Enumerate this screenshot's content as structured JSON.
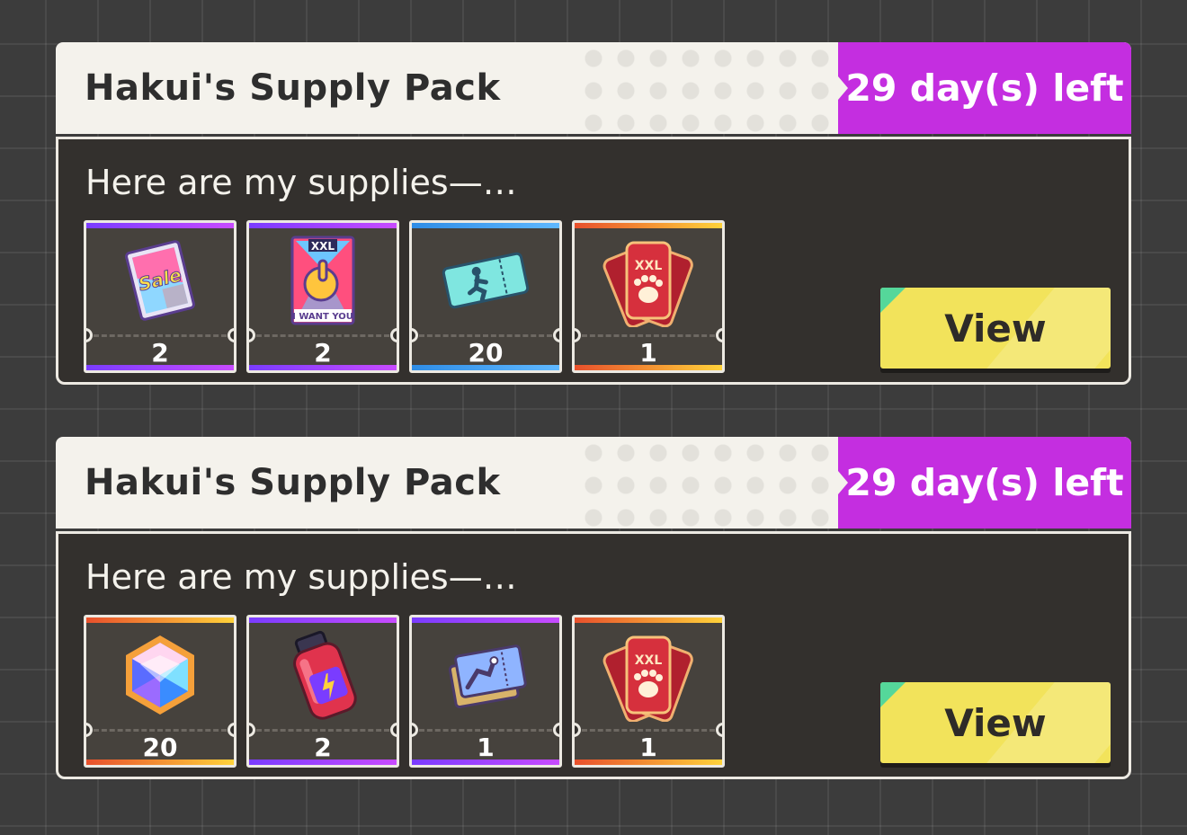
{
  "packs": [
    {
      "title": "Hakui's Supply Pack",
      "days_left": "29 day(s) left",
      "description": "Here are my supplies—…",
      "view_label": "View",
      "items": [
        {
          "icon": "sale-flyer-icon",
          "quantity": "2",
          "rarity": "purple"
        },
        {
          "icon": "recruitment-poster-icon",
          "quantity": "2",
          "rarity": "purple"
        },
        {
          "icon": "running-ticket-icon",
          "quantity": "20",
          "rarity": "blue"
        },
        {
          "icon": "paw-ticket-icon",
          "quantity": "1",
          "rarity": "gold",
          "text": "XXL"
        }
      ]
    },
    {
      "title": "Hakui's Supply Pack",
      "days_left": "29 day(s) left",
      "description": "Here are my supplies—…",
      "view_label": "View",
      "items": [
        {
          "icon": "gem-icon",
          "quantity": "20",
          "rarity": "gold"
        },
        {
          "icon": "energy-bottle-icon",
          "quantity": "2",
          "rarity": "purple"
        },
        {
          "icon": "blueprint-ticket-icon",
          "quantity": "1",
          "rarity": "purple"
        },
        {
          "icon": "paw-ticket-icon",
          "quantity": "1",
          "rarity": "gold",
          "text": "XXL"
        }
      ]
    }
  ],
  "poster_text": {
    "top": "XXL",
    "bottom": "I WANT YOU"
  },
  "flyer_text": "Sale",
  "colors": {
    "badge": "#c42ee0",
    "view_button": "#f2e35b",
    "panel": "#33302d",
    "header": "#f4f2ec"
  }
}
